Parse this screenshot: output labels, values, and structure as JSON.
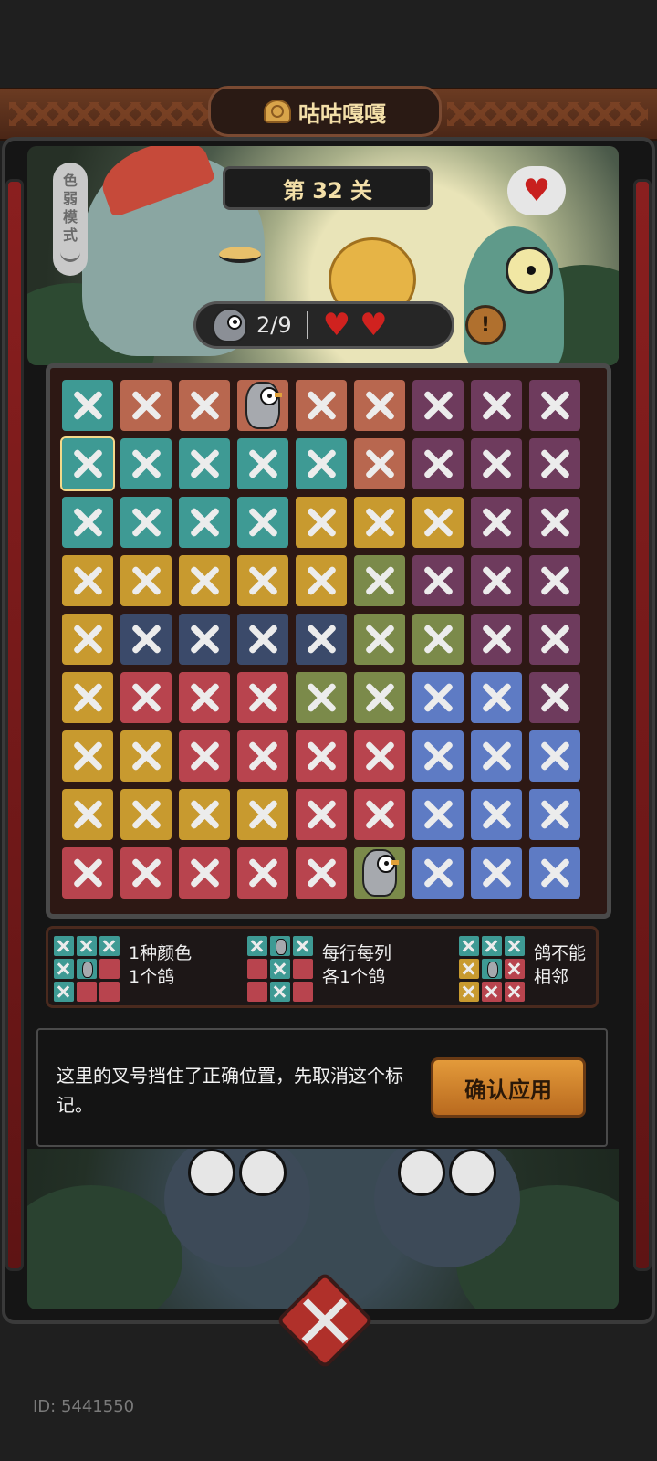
{
  "header": {
    "title": "咕咕嘎嘎"
  },
  "level": {
    "label": "第 32 关"
  },
  "colorblind_mode": {
    "label": [
      "色",
      "弱",
      "模",
      "式"
    ]
  },
  "status": {
    "pigeons": "2/9",
    "hearts": 2
  },
  "colors": {
    "teal": "#3e9a94",
    "orange": "#b8674f",
    "purple": "#6e3b5d",
    "yellow": "#c89a2f",
    "olive": "#7b8a4a",
    "navy": "#3b4a6a",
    "red": "#b8444e",
    "blue": "#5e7bc4"
  },
  "board": {
    "rows": [
      [
        [
          "teal",
          "x"
        ],
        [
          "orange",
          "x"
        ],
        [
          "orange",
          "x"
        ],
        [
          "orange",
          "pigeon"
        ],
        [
          "orange",
          "x"
        ],
        [
          "orange",
          "x"
        ],
        [
          "purple",
          "x"
        ],
        [
          "purple",
          "x"
        ],
        [
          "purple",
          "x"
        ]
      ],
      [
        [
          "teal",
          "x"
        ],
        [
          "teal",
          "x"
        ],
        [
          "teal",
          "x"
        ],
        [
          "teal",
          "x"
        ],
        [
          "teal",
          "x"
        ],
        [
          "orange",
          "x"
        ],
        [
          "purple",
          "x"
        ],
        [
          "purple",
          "x"
        ],
        [
          "purple",
          "x"
        ]
      ],
      [
        [
          "teal",
          "x"
        ],
        [
          "teal",
          "x"
        ],
        [
          "teal",
          "x"
        ],
        [
          "teal",
          "x"
        ],
        [
          "yellow",
          "x"
        ],
        [
          "yellow",
          "x"
        ],
        [
          "yellow",
          "x"
        ],
        [
          "purple",
          "x"
        ],
        [
          "purple",
          "x"
        ]
      ],
      [
        [
          "yellow",
          "x"
        ],
        [
          "yellow",
          "x"
        ],
        [
          "yellow",
          "x"
        ],
        [
          "yellow",
          "x"
        ],
        [
          "yellow",
          "x"
        ],
        [
          "olive",
          "x"
        ],
        [
          "purple",
          "x"
        ],
        [
          "purple",
          "x"
        ],
        [
          "purple",
          "x"
        ]
      ],
      [
        [
          "yellow",
          "x"
        ],
        [
          "navy",
          "x"
        ],
        [
          "navy",
          "x"
        ],
        [
          "navy",
          "x"
        ],
        [
          "navy",
          "x"
        ],
        [
          "olive",
          "x"
        ],
        [
          "olive",
          "x"
        ],
        [
          "purple",
          "x"
        ],
        [
          "purple",
          "x"
        ]
      ],
      [
        [
          "yellow",
          "x"
        ],
        [
          "red",
          "x"
        ],
        [
          "red",
          "x"
        ],
        [
          "red",
          "x"
        ],
        [
          "olive",
          "x"
        ],
        [
          "olive",
          "x"
        ],
        [
          "blue",
          "x"
        ],
        [
          "blue",
          "x"
        ],
        [
          "purple",
          "x"
        ]
      ],
      [
        [
          "yellow",
          "x"
        ],
        [
          "yellow",
          "x"
        ],
        [
          "red",
          "x"
        ],
        [
          "red",
          "x"
        ],
        [
          "red",
          "x"
        ],
        [
          "red",
          "x"
        ],
        [
          "blue",
          "x"
        ],
        [
          "blue",
          "x"
        ],
        [
          "blue",
          "x"
        ]
      ],
      [
        [
          "yellow",
          "x"
        ],
        [
          "yellow",
          "x"
        ],
        [
          "yellow",
          "x"
        ],
        [
          "yellow",
          "x"
        ],
        [
          "red",
          "x"
        ],
        [
          "red",
          "x"
        ],
        [
          "blue",
          "x"
        ],
        [
          "blue",
          "x"
        ],
        [
          "blue",
          "x"
        ]
      ],
      [
        [
          "red",
          "x"
        ],
        [
          "red",
          "x"
        ],
        [
          "red",
          "x"
        ],
        [
          "red",
          "x"
        ],
        [
          "red",
          "x"
        ],
        [
          "olive",
          "pigeon"
        ],
        [
          "blue",
          "x"
        ],
        [
          "blue",
          "x"
        ],
        [
          "blue",
          "x"
        ]
      ]
    ],
    "selected": [
      1,
      0
    ]
  },
  "rules": [
    {
      "line1": "1种颜色",
      "line2": "1个鸽"
    },
    {
      "line1": "每行每列",
      "line2": "各1个鸽"
    },
    {
      "line1": "鸽不能",
      "line2": "相邻"
    }
  ],
  "message": {
    "text": "这里的叉号挡住了正确位置，先取消这个标记。",
    "button": "确认应用"
  },
  "footer": {
    "id": "ID: 5441550"
  }
}
